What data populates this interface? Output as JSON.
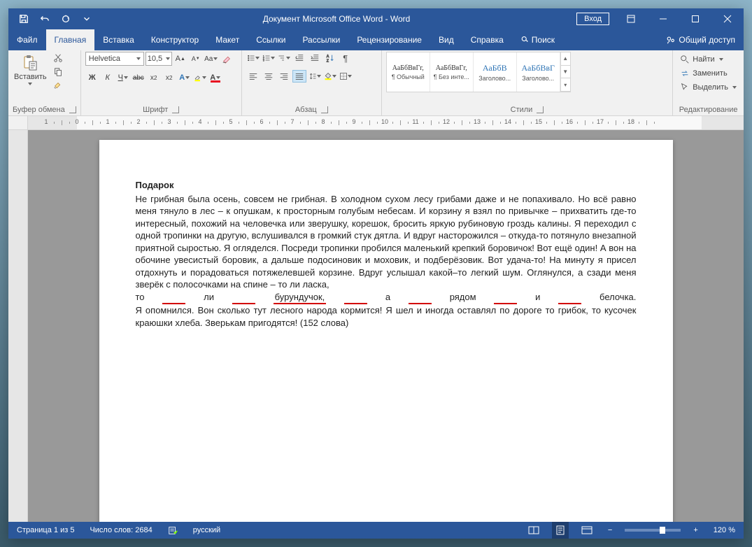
{
  "title": "Документ Microsoft Office Word  -  Word",
  "signin": "Вход",
  "tabs": {
    "file": "Файл",
    "home": "Главная",
    "insert": "Вставка",
    "design": "Конструктор",
    "layout": "Макет",
    "references": "Ссылки",
    "mailings": "Рассылки",
    "review": "Рецензирование",
    "view": "Вид",
    "help": "Справка",
    "tellme": "Поиск",
    "share": "Общий доступ"
  },
  "ribbon": {
    "clipboard": {
      "paste": "Вставить",
      "label": "Буфер обмена"
    },
    "font": {
      "name": "Helvetica",
      "size": "10,5",
      "label": "Шрифт"
    },
    "paragraph": {
      "label": "Абзац"
    },
    "styles": {
      "label": "Стили",
      "items": [
        {
          "preview": "АаБбВвГг,",
          "name": "¶ Обычный"
        },
        {
          "preview": "АаБбВвГг,",
          "name": "¶ Без инте..."
        },
        {
          "preview": "АаБбВ",
          "name": "Заголово...",
          "head": true
        },
        {
          "preview": "АаБбВвГ",
          "name": "Заголово...",
          "head": true
        }
      ]
    },
    "editing": {
      "label": "Редактирование",
      "find": "Найти",
      "replace": "Заменить",
      "select": "Выделить"
    }
  },
  "document": {
    "title": "Подарок",
    "p1": "Не грибная была осень, совсем не грибная. В холодном сухом лесу грибами даже и не попахивало. Но всё равно меня тянуло в лес – к опушкам, к просторным голубым небесам. И корзину я взял по привычке – прихватить где-то интересный, похожий на человечка или зверушку, корешок, бросить яркую рубиновую гроздь калины. Я переходил с одной тропинки на другую, вслушивался в громкий стук дятла. И вдруг насторожился – откуда-то потянуло внезапной приятной сыростью. Я огляделся. Посреди тропинки пробился маленький крепкий боровичок! Вот ещё один! А вон на обочине увесистый боровик, а дальше подосиновик и моховик, и подберёзовик. Вот удача-то! На минуту я присел отдохнуть и порадоваться потяжелевшей корзине. Вдруг услышал какой–то легкий шум. Оглянулся, а сзади меня зверёк с полосочками на спине – то ли ласка,",
    "squig": {
      "w1": "то",
      "w2": "ли",
      "w3": "бурундучок,",
      "w4": "а",
      "w5": "рядом",
      "w6": "и",
      "w7": "белочка."
    },
    "p2": "Я опомнился. Вон сколько тут лесного народа кормится! Я шел и иногда оставлял по дороге то грибок, то кусочек краюшки хлеба. Зверькам пригодятся! (152 слова)"
  },
  "statusbar": {
    "page": "Страница 1 из 5",
    "words": "Число слов: 2684",
    "lang": "русский",
    "zoom": "120 %"
  }
}
